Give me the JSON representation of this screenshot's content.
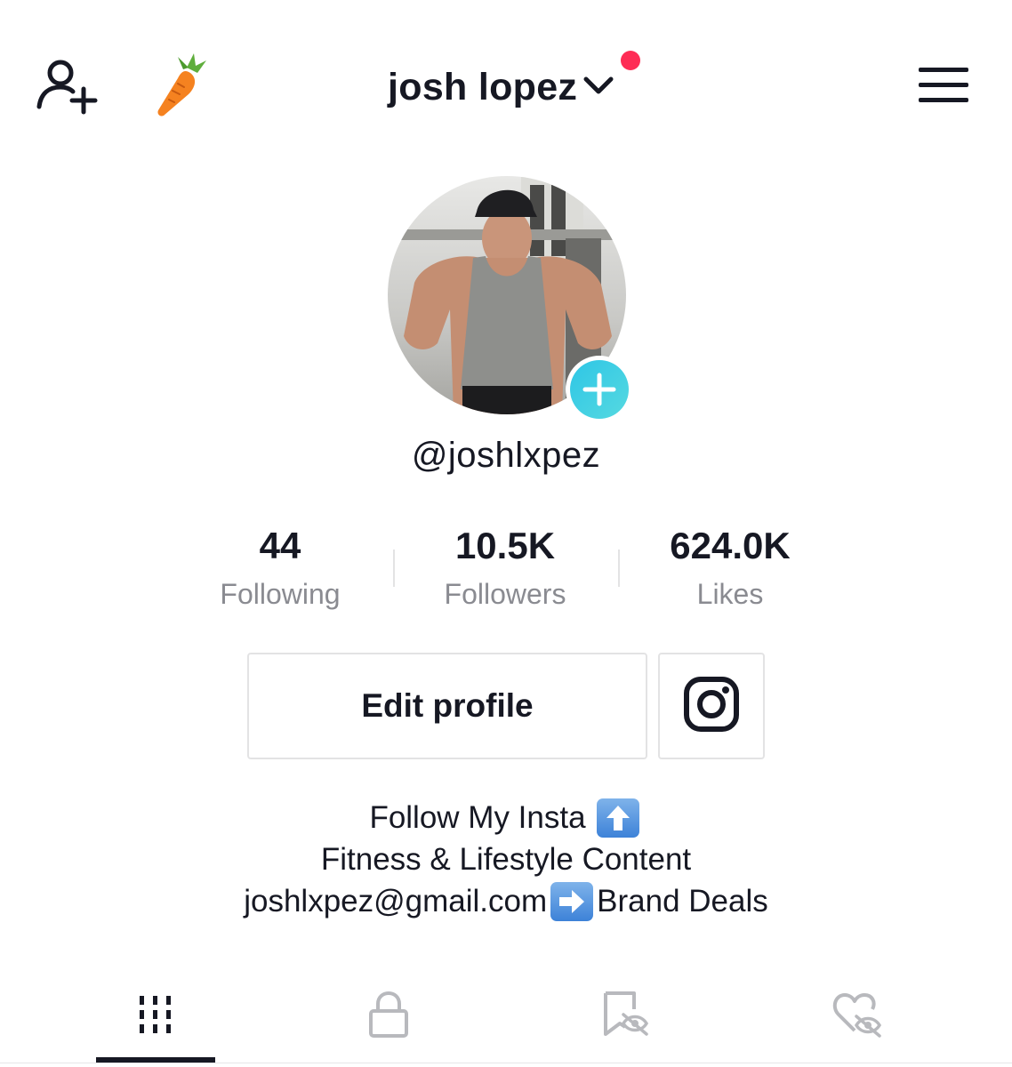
{
  "header": {
    "account_name": "josh lopez",
    "icons": [
      "add-user-icon",
      "carrot-icon",
      "chevron-down-icon",
      "menu-icon"
    ],
    "notification_color": "#fe2c55"
  },
  "profile": {
    "handle": "@joshlxpez",
    "avatar_add_color": "#2ec6e6"
  },
  "stats": [
    {
      "value": "44",
      "label": "Following"
    },
    {
      "value": "10.5K",
      "label": "Followers"
    },
    {
      "value": "624.0K",
      "label": "Likes"
    }
  ],
  "actions": {
    "edit_profile": "Edit profile",
    "instagram_icon": "instagram-icon"
  },
  "bio": {
    "line1": "Follow My Insta",
    "line1_emoji": "up-arrow-emoji",
    "line2": "Fitness & Lifestyle Content",
    "line3_a": "joshlxpez@gmail.com",
    "line3_emoji": "right-arrow-emoji",
    "line3_b": "Brand Deals"
  },
  "tabs": [
    {
      "icon": "videos-grid-icon",
      "selected": true
    },
    {
      "icon": "lock-icon",
      "selected": false
    },
    {
      "icon": "saved-hidden-icon",
      "selected": false
    },
    {
      "icon": "liked-hidden-icon",
      "selected": false
    }
  ]
}
